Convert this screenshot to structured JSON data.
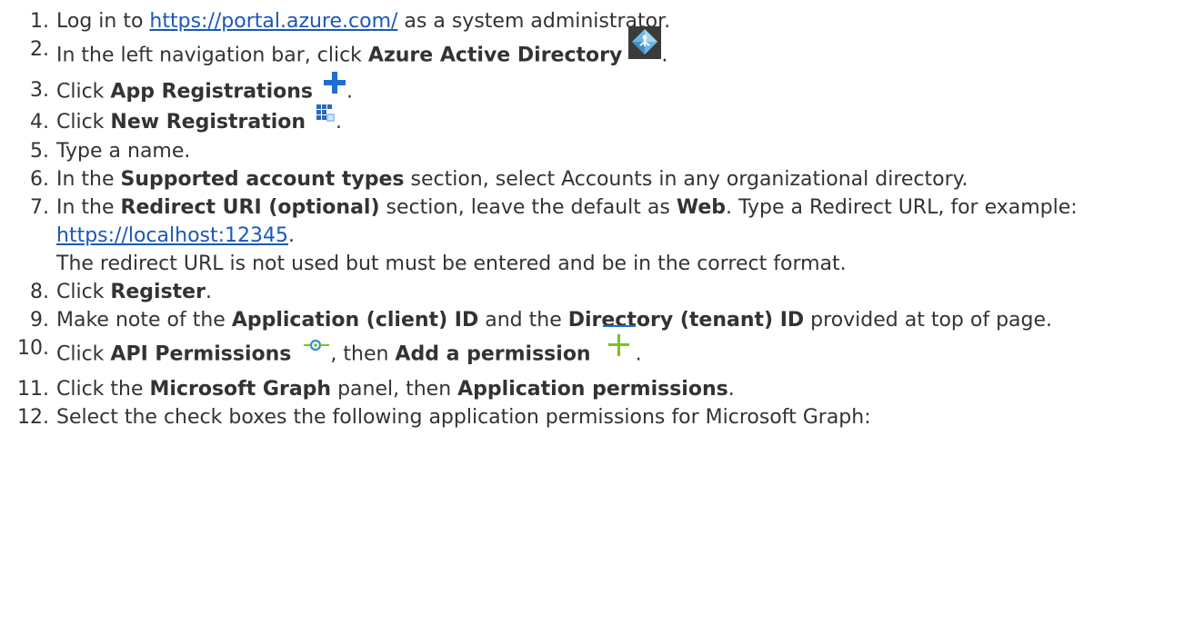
{
  "steps": [
    {
      "num": "1.",
      "a": "Log in to ",
      "link": "https://portal.azure.com/",
      "b": " as a system administrator."
    },
    {
      "num": "2.",
      "a": "In the left navigation bar, click ",
      "bold": "Azure Active Directory",
      "b": ".",
      "icon": "azure-active-directory-icon"
    },
    {
      "num": "3.",
      "a": "Click ",
      "bold": "App Registrations",
      "b": ".",
      "icon": "plus-icon"
    },
    {
      "num": "4.",
      "a": "Click ",
      "bold": "New Registration",
      "b": ".",
      "icon": "new-registration-icon"
    },
    {
      "num": "5.",
      "a": "Type a name."
    },
    {
      "num": "6.",
      "a": "In the ",
      "bold": "Supported account types",
      "b": " section, select Accounts in any organizational directory."
    },
    {
      "num": "7.",
      "a": "In the ",
      "bold": "Redirect URI (optional)",
      "b": " section, leave the default as ",
      "bold2": "Web",
      "c": ". Type a Redirect URL, for example:",
      "link": "https://localhost:12345",
      "d": ".",
      "note": "The redirect URL is not used but must be entered and be in the correct format."
    },
    {
      "num": "8.",
      "a": "Click ",
      "bold": "Register",
      "b": "."
    },
    {
      "num": "9.",
      "a": "Make note of the ",
      "bold": "Application (client) ID",
      "b": " and the ",
      "bold2": "Directory (tenant) ID",
      "c": " provided at top of page."
    },
    {
      "num": "10.",
      "a": "Click ",
      "bold": "API Permissions",
      "b": ", then ",
      "bold2": "Add a permission",
      "c": ".",
      "icon": "api-permissions-icon",
      "icon2": "add-permission-icon"
    },
    {
      "num": "11.",
      "a": "Click the ",
      "bold": "Microsoft Graph",
      "b": " panel, then ",
      "bold2": "Application permissions",
      "c": "."
    },
    {
      "num": "12.",
      "a": "Select the check boxes the following application permissions for Microsoft Graph:"
    }
  ],
  "colors": {
    "link": "#1a58b8",
    "text": "#333333",
    "plus_blue": "#1f6fd1",
    "plus_green": "#7cc21d"
  }
}
